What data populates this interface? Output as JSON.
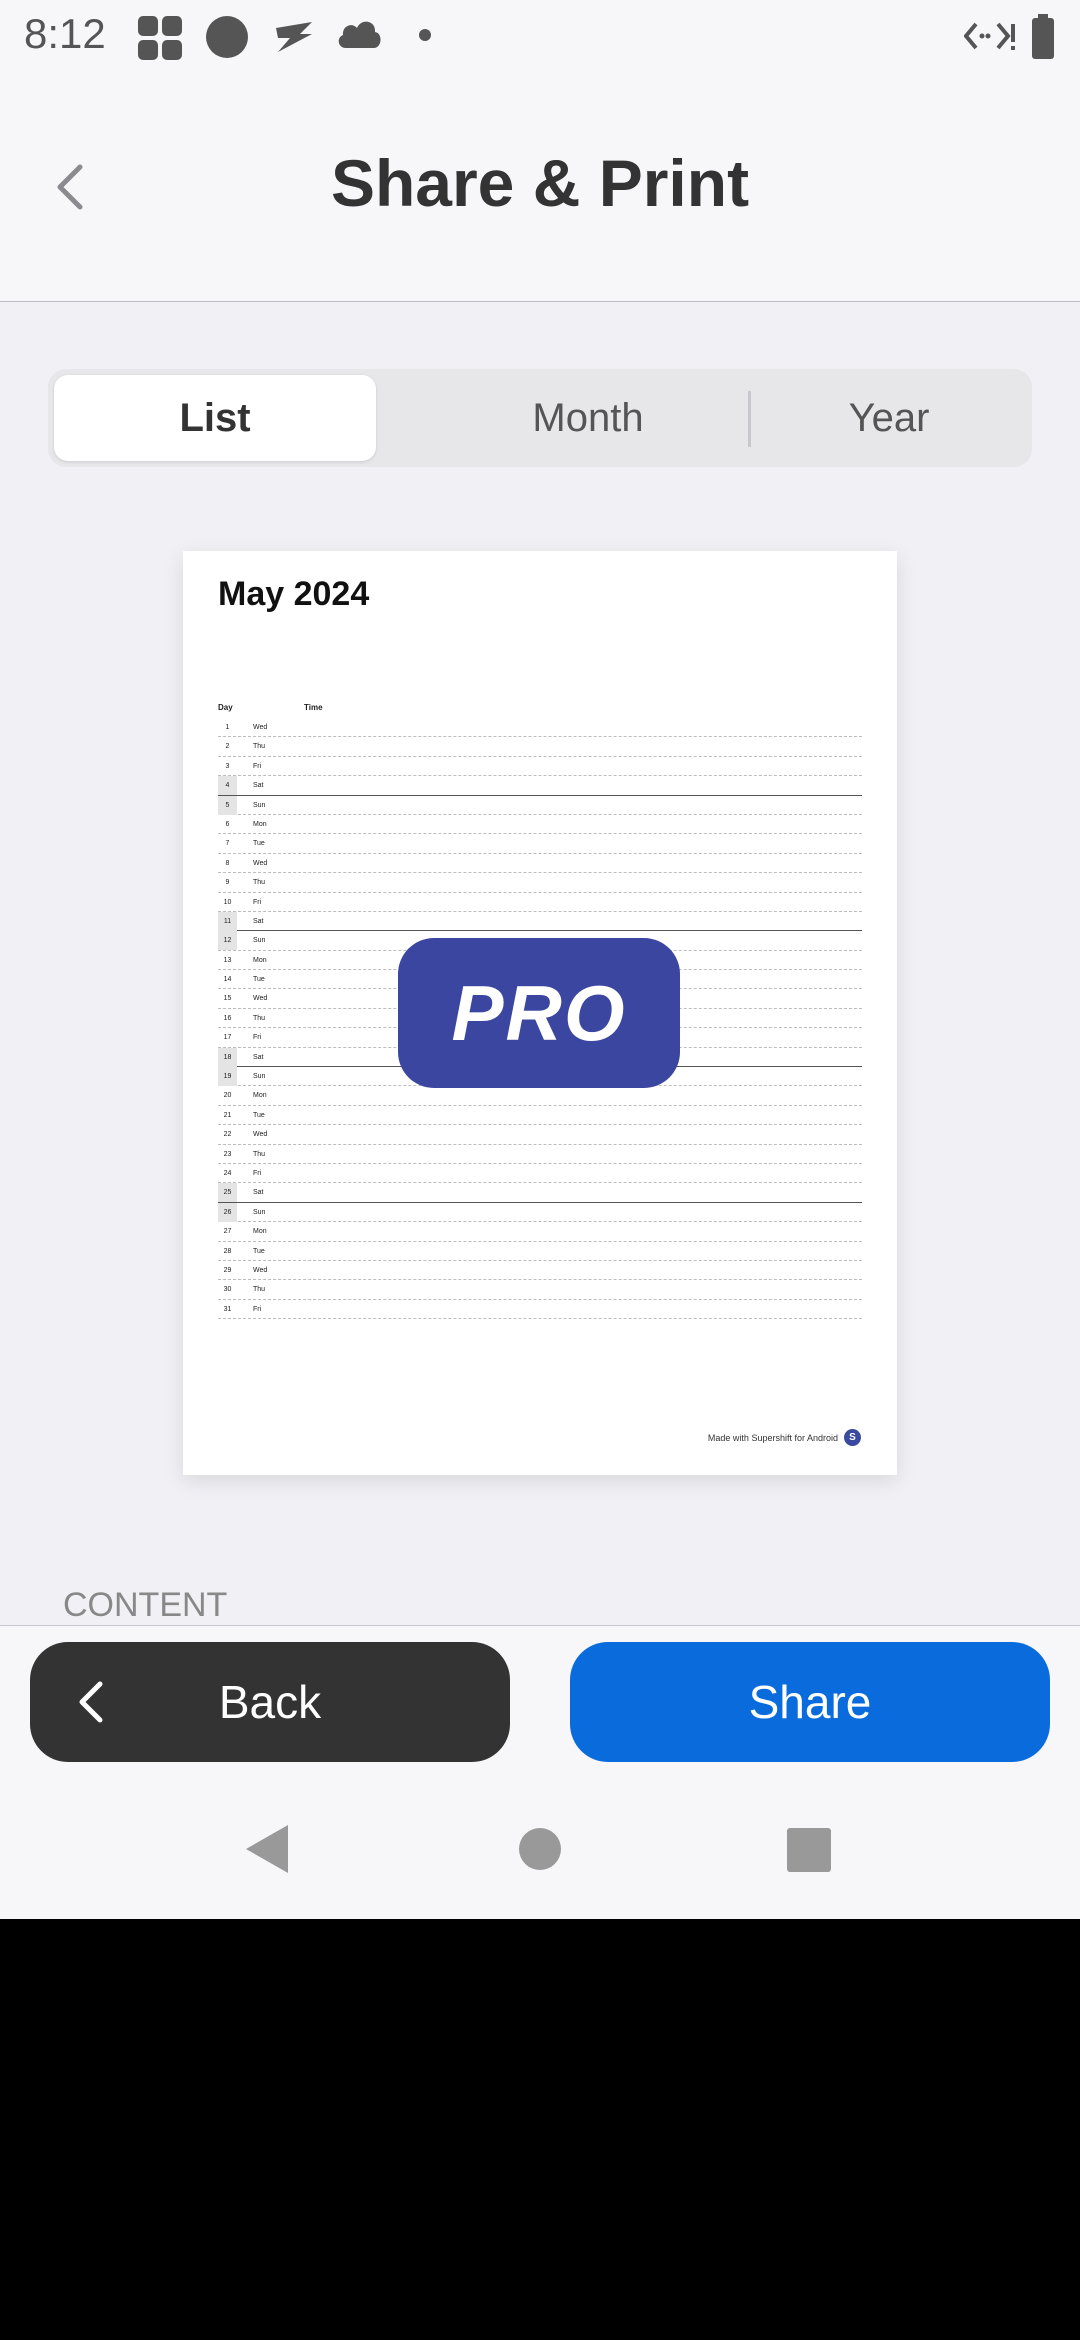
{
  "status_bar": {
    "time": "8:12"
  },
  "header": {
    "title": "Share & Print"
  },
  "tabs": [
    {
      "label": "List",
      "active": true
    },
    {
      "label": "Month",
      "active": false
    },
    {
      "label": "Year",
      "active": false
    }
  ],
  "preview": {
    "title": "May 2024",
    "col_day": "Day",
    "col_time": "Time",
    "rows": [
      {
        "d": "1",
        "w": "Wed"
      },
      {
        "d": "2",
        "w": "Thu"
      },
      {
        "d": "3",
        "w": "Fri"
      },
      {
        "d": "4",
        "w": "Sat"
      },
      {
        "d": "5",
        "w": "Sun"
      },
      {
        "d": "6",
        "w": "Mon"
      },
      {
        "d": "7",
        "w": "Tue"
      },
      {
        "d": "8",
        "w": "Wed"
      },
      {
        "d": "9",
        "w": "Thu"
      },
      {
        "d": "10",
        "w": "Fri"
      },
      {
        "d": "11",
        "w": "Sat"
      },
      {
        "d": "12",
        "w": "Sun"
      },
      {
        "d": "13",
        "w": "Mon"
      },
      {
        "d": "14",
        "w": "Tue"
      },
      {
        "d": "15",
        "w": "Wed"
      },
      {
        "d": "16",
        "w": "Thu"
      },
      {
        "d": "17",
        "w": "Fri"
      },
      {
        "d": "18",
        "w": "Sat"
      },
      {
        "d": "19",
        "w": "Sun"
      },
      {
        "d": "20",
        "w": "Mon"
      },
      {
        "d": "21",
        "w": "Tue"
      },
      {
        "d": "22",
        "w": "Wed"
      },
      {
        "d": "23",
        "w": "Thu"
      },
      {
        "d": "24",
        "w": "Fri"
      },
      {
        "d": "25",
        "w": "Sat"
      },
      {
        "d": "26",
        "w": "Sun"
      },
      {
        "d": "27",
        "w": "Mon"
      },
      {
        "d": "28",
        "w": "Tue"
      },
      {
        "d": "29",
        "w": "Wed"
      },
      {
        "d": "30",
        "w": "Thu"
      },
      {
        "d": "31",
        "w": "Fri"
      }
    ],
    "footer": "Made with Supershift for Android",
    "footer_logo": "S"
  },
  "pro_badge": "PRO",
  "section_label": "CONTENT",
  "buttons": {
    "back": "Back",
    "share": "Share"
  },
  "colors": {
    "share": "#0a6cdc",
    "back": "#333333",
    "pro": "#3a46a0"
  }
}
